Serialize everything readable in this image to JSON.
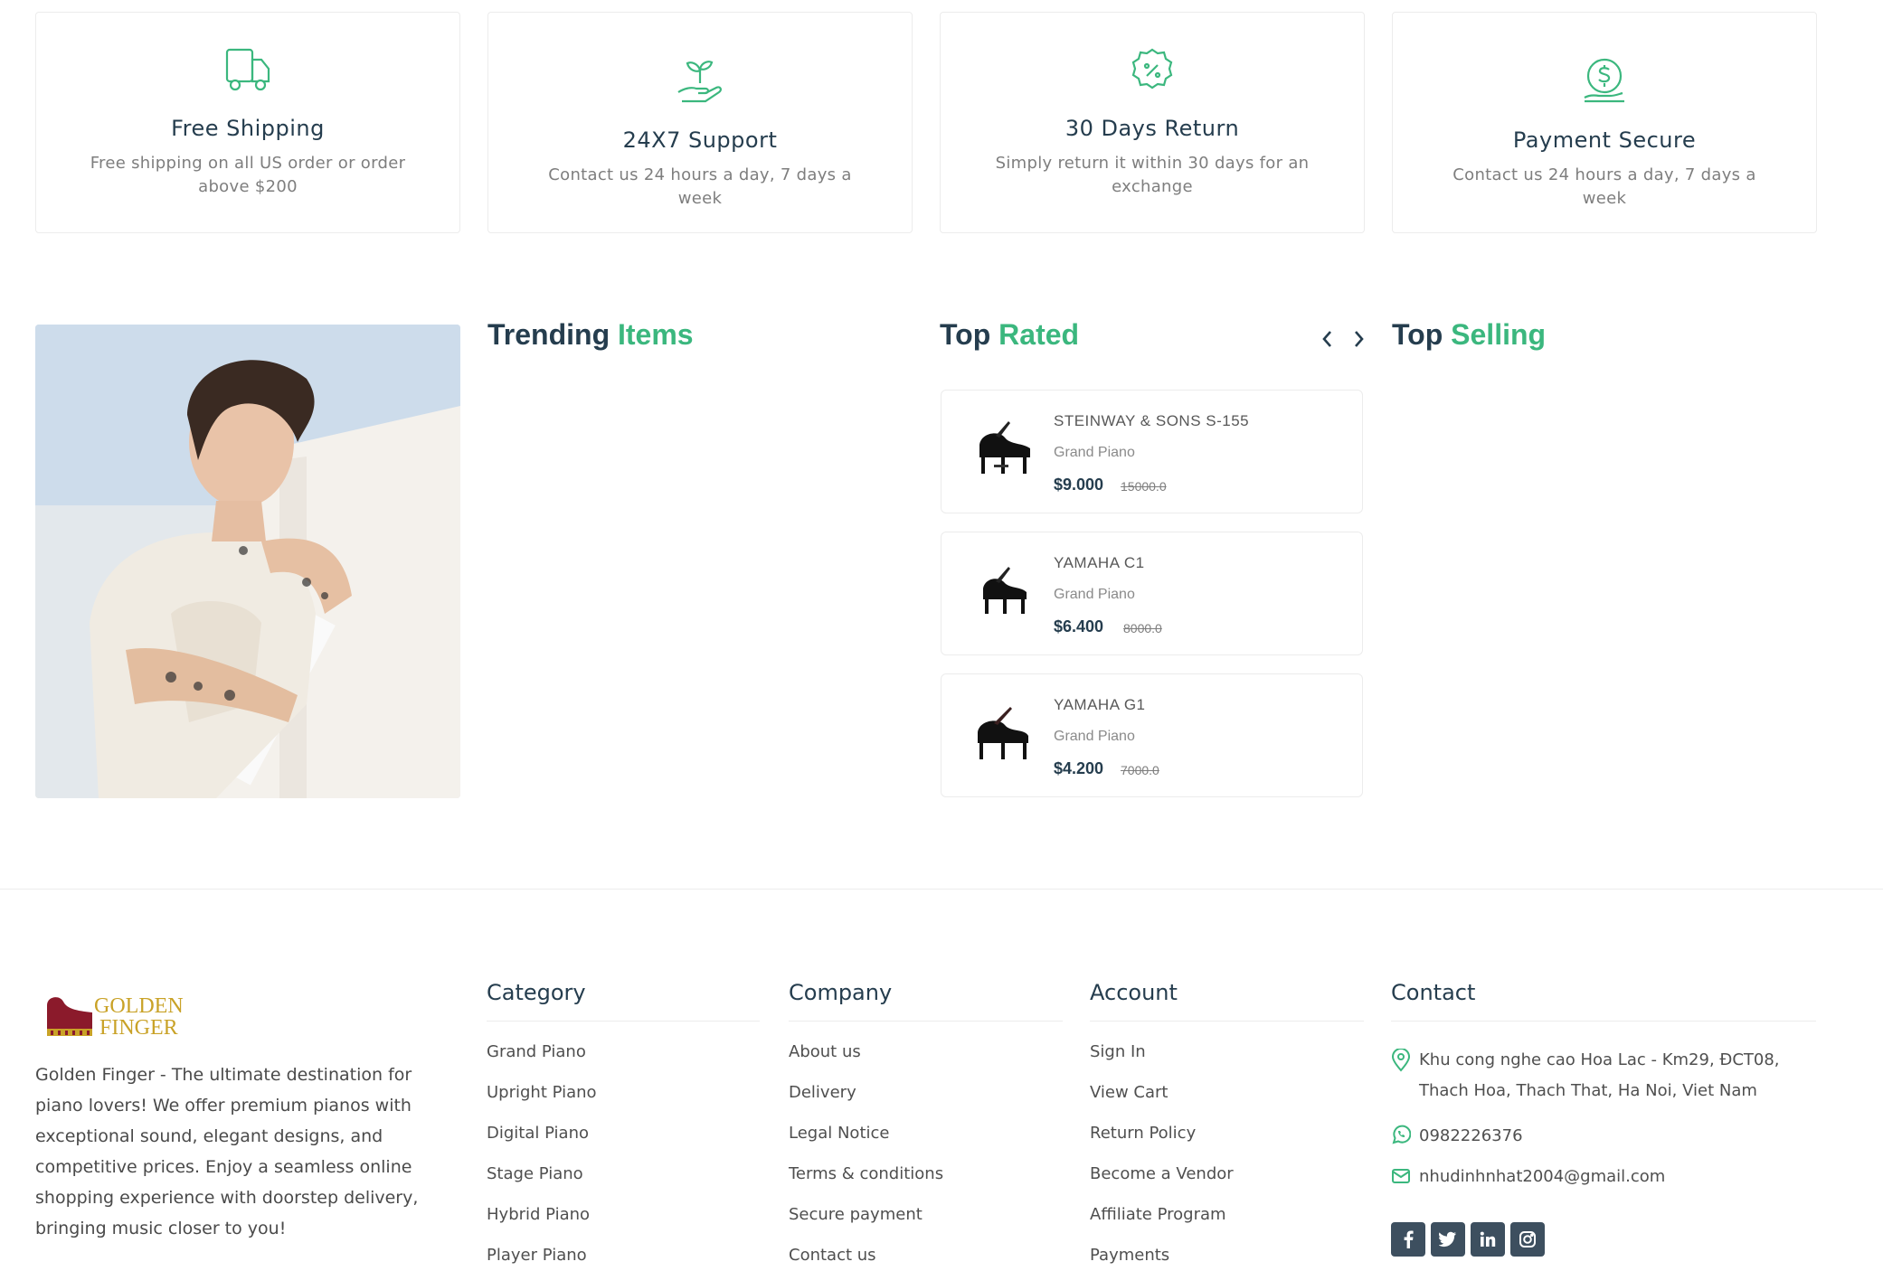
{
  "features": [
    {
      "icon": "truck-icon",
      "title": "Free Shipping",
      "desc": "Free shipping on all US order or order above $200"
    },
    {
      "icon": "plant-hand-icon",
      "title": "24X7 Support",
      "desc": "Contact us 24 hours a day, 7 days a week"
    },
    {
      "icon": "percent-badge-icon",
      "title": "30 Days Return",
      "desc": "Simply return it within 30 days for an exchange"
    },
    {
      "icon": "dollar-hand-icon",
      "title": "Payment Secure",
      "desc": "Contact us 24 hours a day, 7 days a week"
    }
  ],
  "sections": {
    "trending": {
      "word1": "Trending",
      "word2": "Items"
    },
    "top_rated": {
      "word1": "Top",
      "word2": "Rated"
    },
    "top_selling": {
      "word1": "Top",
      "word2": "Selling"
    }
  },
  "top_rated_products": [
    {
      "name": "STEINWAY & SONS S-155",
      "category": "Grand Piano",
      "price": "$9.000",
      "old_price": "15000.0"
    },
    {
      "name": "YAMAHA C1",
      "category": "Grand Piano",
      "price": "$6.400",
      "old_price": "8000.0"
    },
    {
      "name": "YAMAHA G1",
      "category": "Grand Piano",
      "price": "$4.200",
      "old_price": "7000.0"
    }
  ],
  "footer": {
    "logo_text_1": "GOLDEN",
    "logo_text_2": "FINGER",
    "about": "Golden Finger - The ultimate destination for piano lovers! We offer premium pianos with exceptional sound, elegant designs, and competitive prices. Enjoy a seamless online shopping experience with doorstep delivery, bringing music closer to you!",
    "category": {
      "title": "Category",
      "items": [
        "Grand Piano",
        "Upright Piano",
        "Digital Piano",
        "Stage Piano",
        "Hybrid Piano",
        "Player Piano"
      ]
    },
    "company": {
      "title": "Company",
      "items": [
        "About us",
        "Delivery",
        "Legal Notice",
        "Terms & conditions",
        "Secure payment",
        "Contact us"
      ]
    },
    "account": {
      "title": "Account",
      "items": [
        "Sign In",
        "View Cart",
        "Return Policy",
        "Become a Vendor",
        "Affiliate Program",
        "Payments"
      ]
    },
    "contact": {
      "title": "Contact",
      "address_line1": "Khu cong nghe cao Hoa Lac - Km29, ĐCT08,",
      "address_line2": "Thach Hoa, Thach That, Ha Noi, Viet Nam",
      "phone": "0982226376",
      "email": "nhudinhnhat2004@gmail.com"
    },
    "social": [
      "f",
      "t",
      "in",
      "ig"
    ]
  },
  "colors": {
    "accent": "#3bb77e",
    "heading": "#253d4e",
    "social_bg": "#3d4f5f"
  }
}
